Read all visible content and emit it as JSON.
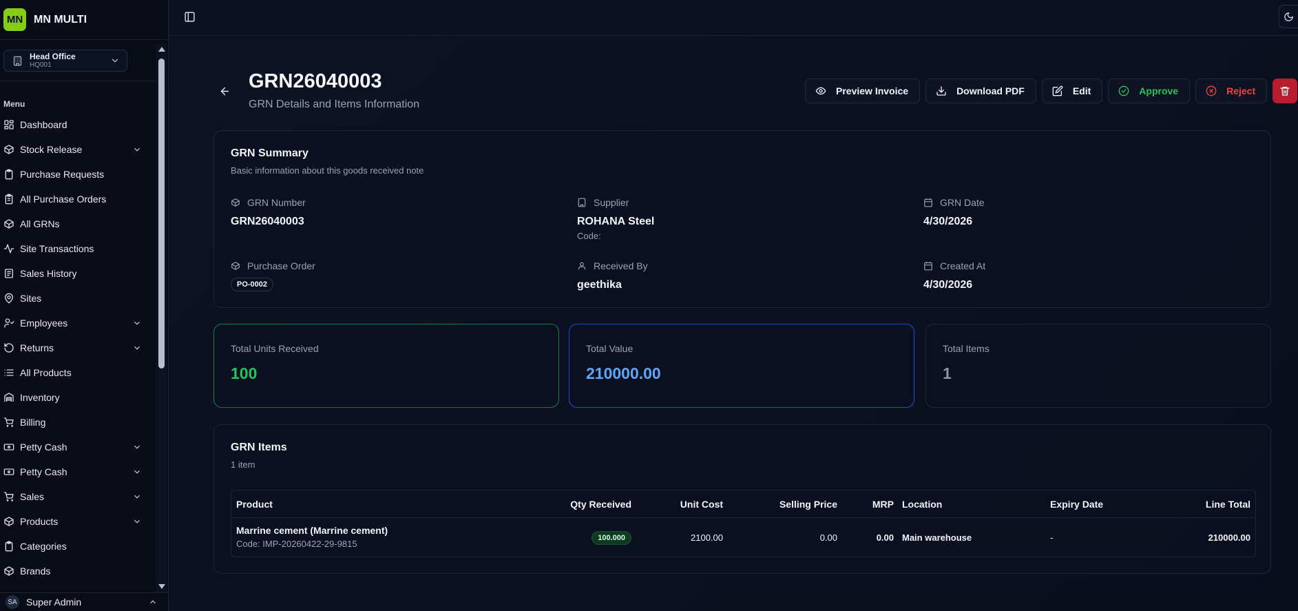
{
  "brand": {
    "logo": "MN",
    "name": "MN MULTI"
  },
  "branch": {
    "name": "Head Office",
    "code": "HQ001"
  },
  "menu": {
    "heading": "Menu",
    "items": [
      {
        "label": "Dashboard",
        "icon": "layout-grid-icon"
      },
      {
        "label": "Stock Release",
        "icon": "package-icon"
      },
      {
        "label": "Purchase Requests",
        "icon": "clipboard-icon"
      },
      {
        "label": "All Purchase Orders",
        "icon": "clipboard-list-icon"
      },
      {
        "label": "All GRNs",
        "icon": "package-icon"
      },
      {
        "label": "Site Transactions",
        "icon": "activity-icon"
      },
      {
        "label": "Sales History",
        "icon": "receipt-icon"
      },
      {
        "label": "Sites",
        "icon": "map-pin-icon"
      },
      {
        "label": "Employees",
        "icon": "user-check-icon"
      },
      {
        "label": "Returns",
        "icon": "rotate-icon"
      },
      {
        "label": "All Products",
        "icon": "list-icon"
      },
      {
        "label": "Inventory",
        "icon": "warehouse-icon"
      },
      {
        "label": "Billing",
        "icon": "cart-icon"
      },
      {
        "label": "Petty Cash",
        "icon": "cash-icon"
      },
      {
        "label": "Petty Cash",
        "icon": "cash-icon"
      },
      {
        "label": "Sales",
        "icon": "cart-icon"
      },
      {
        "label": "Products",
        "icon": "package-icon"
      },
      {
        "label": "Categories",
        "icon": "clipboard-icon"
      },
      {
        "label": "Brands",
        "icon": "package-icon"
      }
    ]
  },
  "user": {
    "initials": "SA",
    "name": "Super Admin"
  },
  "page": {
    "title": "GRN26040003",
    "subtitle": "GRN Details and Items Information"
  },
  "actions": {
    "preview": "Preview Invoice",
    "download": "Download PDF",
    "edit": "Edit",
    "approve": "Approve",
    "reject": "Reject"
  },
  "summary": {
    "title": "GRN Summary",
    "subtitle": "Basic information about this goods received note",
    "grn_number": {
      "label": "GRN Number",
      "value": "GRN26040003"
    },
    "supplier": {
      "label": "Supplier",
      "value": "ROHANA Steel",
      "code": "Code:"
    },
    "grn_date": {
      "label": "GRN Date",
      "value": "4/30/2026"
    },
    "purchase_order": {
      "label": "Purchase Order",
      "value": "PO-0002"
    },
    "received_by": {
      "label": "Received By",
      "value": "geethika"
    },
    "created_at": {
      "label": "Created At",
      "value": "4/30/2026"
    }
  },
  "stats": {
    "units": {
      "label": "Total Units Received",
      "value": "100"
    },
    "value": {
      "label": "Total Value",
      "value": "210000.00"
    },
    "items": {
      "label": "Total Items",
      "value": "1"
    }
  },
  "items": {
    "title": "GRN Items",
    "count": "1 item",
    "columns": {
      "product": "Product",
      "qty": "Qty Received",
      "unit_cost": "Unit Cost",
      "selling_price": "Selling Price",
      "mrp": "MRP",
      "location": "Location",
      "expiry": "Expiry Date",
      "line_total": "Line Total"
    },
    "rows": [
      {
        "product": "Marrine cement (Marrine cement)",
        "code": "Code: IMP-20260422-29-9815",
        "qty": "100.000",
        "unit_cost": "2100.00",
        "selling_price": "0.00",
        "mrp": "0.00",
        "location": "Main warehouse",
        "expiry": "-",
        "line_total": "210000.00"
      }
    ]
  },
  "colors": {
    "brand": "#84cc16",
    "approve": "#22c55e",
    "reject": "#ef4444",
    "delete_bg": "#b91c2c",
    "value_blue": "#60a5fa"
  }
}
